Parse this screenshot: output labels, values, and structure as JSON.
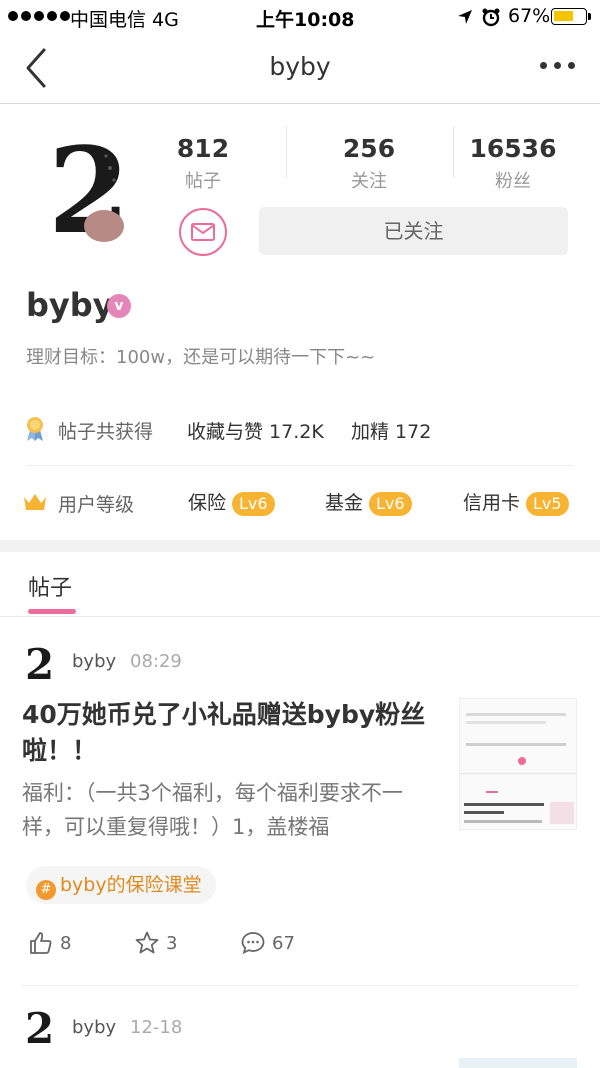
{
  "status_bar": {
    "carrier": "中国电信  4G",
    "time": "上午10:08",
    "battery": "67%",
    "battery_level": 0.67
  },
  "nav": {
    "title": "byby"
  },
  "profile": {
    "stats": [
      {
        "value": "812",
        "label": "帖子"
      },
      {
        "value": "256",
        "label": "关注"
      },
      {
        "value": "16536",
        "label": "粉丝"
      }
    ],
    "follow_button": "已关注",
    "username": "byby",
    "verified_badge": "v",
    "bio": "理财目标：100w，还是可以期待一下下~~"
  },
  "achievements": {
    "label": "帖子共获得",
    "favorites": "收藏与赞 17.2K",
    "featured": "加精 172"
  },
  "levels": {
    "label": "用户等级",
    "items": [
      {
        "name": "保险",
        "level": "Lv6"
      },
      {
        "name": "基金",
        "level": "Lv6"
      },
      {
        "name": "信用卡",
        "level": "Lv5"
      }
    ]
  },
  "tabs": {
    "posts": "帖子"
  },
  "posts": [
    {
      "author": "byby",
      "time": "08:29",
      "title": "40万她币兑了小礼品赠送byby粉丝啦！！",
      "excerpt": "福利：（一共3个福利，每个福利要求不一样，可以重复得哦！）1，盖楼福",
      "topic": "byby的保险课堂",
      "likes": "8",
      "stars": "3",
      "comments": "67"
    },
    {
      "author": "byby",
      "time": "12-18"
    }
  ],
  "colors": {
    "accent": "#ec6c9a",
    "level_badge": "#f7b331",
    "topic_text": "#e08a1e"
  }
}
